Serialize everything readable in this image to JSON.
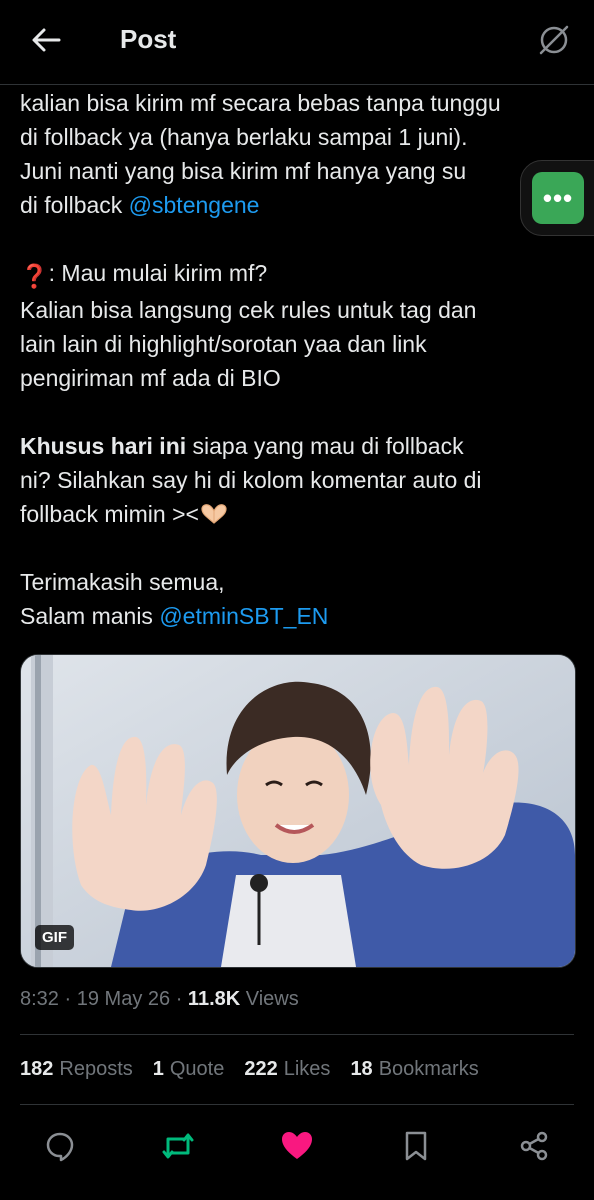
{
  "header": {
    "title": "Post",
    "back_icon": "arrow-left-icon",
    "grok_icon": "grok-slash-icon"
  },
  "post": {
    "line_1": "kalian bisa kirim mf secara bebas tanpa tunggu",
    "line_2": "di follback ya (hanya berlaku sampai 1 juni).",
    "line_3": "Juni nanti yang bisa kirim mf hanya yang su",
    "line_4_prefix": "di follback ",
    "mention_1": "@sbtengene",
    "q_emoji": "❓",
    "line_5": ": Mau mulai kirim mf?",
    "line_6": "Kalian bisa langsung cek rules untuk tag dan",
    "line_7": "lain lain di highlight/sorotan yaa dan link",
    "line_8": "pengiriman mf ada di BIO",
    "bold_text": "Khusus hari ini",
    "line_9_rest": " siapa yang mau di follback",
    "line_10": "ni? Silahkan say hi di kolom komentar  auto di",
    "line_11": "follback mimin ><",
    "line_12": "Terimakasih semua,",
    "line_13_prefix": "Salam manis ",
    "mention_2": "@etminSBT_EN"
  },
  "media": {
    "badge": "GIF"
  },
  "meta": {
    "time": "8:32",
    "sep": "·",
    "date": "19 May 26",
    "views_count": "11.8K",
    "views_label": "Views"
  },
  "stats": {
    "reposts_count": "182",
    "reposts_label": "Reposts",
    "quote_count": "1",
    "quote_label": "Quote",
    "likes_count": "222",
    "likes_label": "Likes",
    "bookmarks_count": "18",
    "bookmarks_label": "Bookmarks"
  },
  "float_menu": {
    "label": "•••"
  },
  "colors": {
    "accent": "#1d9bf0",
    "repost_active": "#00ba7c",
    "like_active": "#f91880",
    "menu_green": "#3aa757"
  }
}
